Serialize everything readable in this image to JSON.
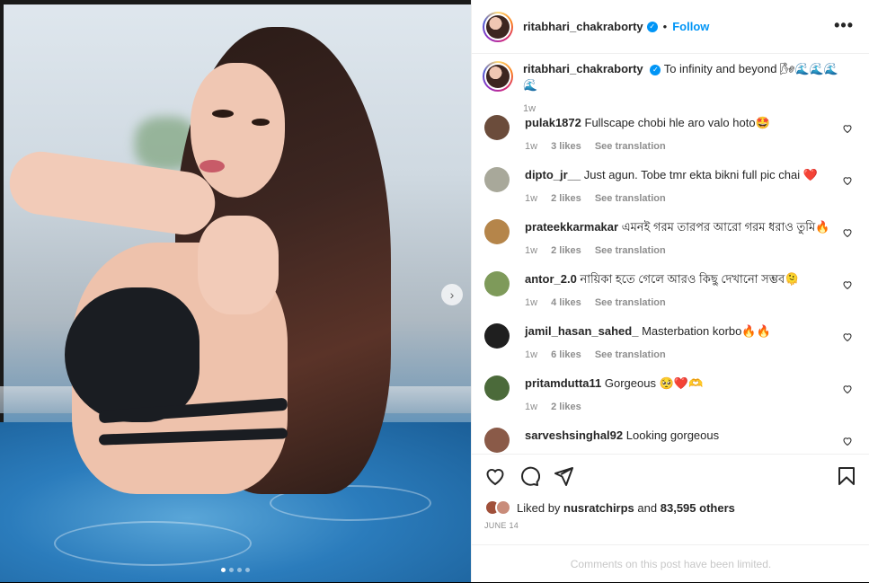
{
  "post": {
    "username": "ritabhari_chakraborty",
    "follow_label": "Follow",
    "separator": "•",
    "more_label": "•••",
    "caption_text": "To infinity and beyond 🌬🌊🌊🌊🌊",
    "caption_time": "1w"
  },
  "comments": [
    {
      "user": "pulak1872",
      "text": "Fullscape chobi hle aro valo hoto🤩",
      "time": "1w",
      "likes": "3 likes",
      "translate": "See translation",
      "color": "#6b4c3b"
    },
    {
      "user": "dipto_jr__",
      "text": "Just agun. Tobe tmr ekta bikni full pic chai ❤️",
      "time": "1w",
      "likes": "2 likes",
      "translate": "See translation",
      "color": "#a8a89a"
    },
    {
      "user": "prateekkarmakar",
      "text": "এমনই গরম তারপর আরো গরম ধরাও তুমি🔥",
      "time": "1w",
      "likes": "2 likes",
      "translate": "See translation",
      "color": "#b5854a"
    },
    {
      "user": "antor_2.0",
      "text": "নায়িকা হতে গেলে আরও কিছু দেখানো সম্ভব🫠",
      "time": "1w",
      "likes": "4 likes",
      "translate": "See translation",
      "color": "#7e9a5a"
    },
    {
      "user": "jamil_hasan_sahed_",
      "text": "Masterbation korbo🔥🔥",
      "time": "1w",
      "likes": "6 likes",
      "translate": "See translation",
      "color": "#1f1f1f"
    },
    {
      "user": "pritamdutta11",
      "text": "Gorgeous 🥺❤️🫶",
      "time": "1w",
      "likes": "2 likes",
      "translate": "",
      "color": "#4b6a3a"
    },
    {
      "user": "sarveshsinghal92",
      "text": "Looking gorgeous",
      "time": "",
      "likes": "",
      "translate": "",
      "color": "#8a5a48"
    }
  ],
  "likes": {
    "prefix": "Liked by",
    "user": "nusratchirps",
    "middle": "and",
    "count": "83,595 others"
  },
  "date": "JUNE 14",
  "limited_notice": "Comments on this post have been limited.",
  "icons": [
    "heart-icon",
    "comment-icon",
    "share-icon",
    "bookmark-icon",
    "chevron-right-icon",
    "more-icon",
    "verified-icon"
  ],
  "colors": {
    "accent": "#0095f6",
    "muted": "#8e8e8e",
    "border": "#efefef"
  }
}
